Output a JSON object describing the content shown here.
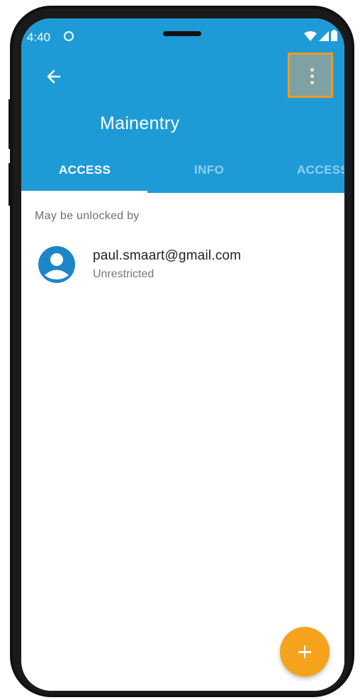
{
  "status_bar": {
    "time": "4:40",
    "icons": [
      "at-sign-icon",
      "wifi-icon",
      "signal-icon",
      "battery-icon"
    ]
  },
  "app_bar": {
    "title": "Mainentry",
    "back_icon": "arrow-left-icon",
    "menu_icon": "more-vertical-icon"
  },
  "tabs": [
    {
      "label": "ACCESS",
      "active": true
    },
    {
      "label": "INFO",
      "active": false
    },
    {
      "label": "ACCESS",
      "active": false
    }
  ],
  "content": {
    "section_label": "May be unlocked by",
    "items": [
      {
        "title": "paul.smaart@gmail.com",
        "subtitle": "Unrestricted",
        "icon": "account-circle-icon"
      }
    ]
  },
  "fab": {
    "icon": "plus-icon"
  },
  "colors": {
    "primary": "#1e9bd7",
    "accent": "#f5a21d",
    "highlight_border": "#f39a1e"
  }
}
